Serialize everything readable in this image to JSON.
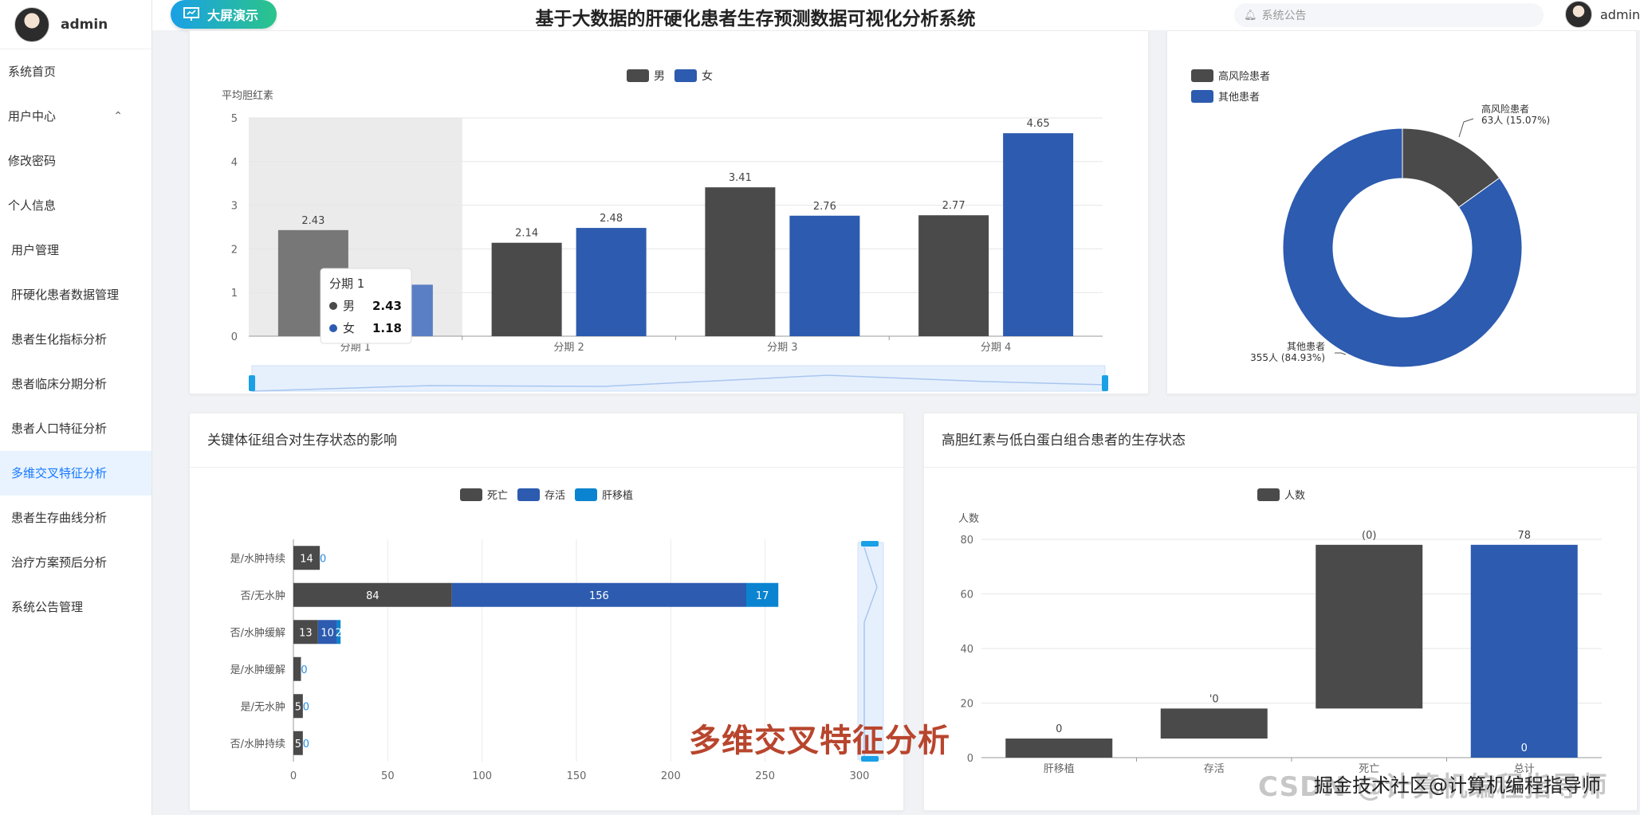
{
  "sidebar": {
    "username": "admin",
    "items": [
      {
        "label": "系统首页"
      },
      {
        "label": "用户中心"
      },
      {
        "label": "修改密码"
      },
      {
        "label": "个人信息"
      },
      {
        "label": "用户管理"
      },
      {
        "label": "肝硬化患者数据管理"
      },
      {
        "label": "患者生化指标分析"
      },
      {
        "label": "患者临床分期分析"
      },
      {
        "label": "患者人口特征分析"
      },
      {
        "label": "多维交叉特征分析"
      },
      {
        "label": "患者生存曲线分析"
      },
      {
        "label": "治疗方案预后分析"
      },
      {
        "label": "系统公告管理"
      }
    ],
    "active_item": "多维交叉特征分析"
  },
  "header": {
    "screen_button": "大屏演示",
    "title": "基于大数据的肝硬化患者生存预测数据可视化分析系统",
    "notice_placeholder": "系统公告",
    "username": "admin"
  },
  "colors": {
    "dark": "#4a4a4a",
    "blue": "#2c5baf",
    "cyan": "#0a84d0",
    "active_bg": "#e8f3ff",
    "active_text": "#1677ff"
  },
  "chart_data": [
    {
      "type": "bar",
      "title": "",
      "ylabel": "平均胆红素",
      "categories": [
        "分期 1",
        "分期 2",
        "分期 3",
        "分期 4"
      ],
      "series": [
        {
          "name": "男",
          "values": [
            2.43,
            2.14,
            3.41,
            2.77
          ]
        },
        {
          "name": "女",
          "values": [
            1.18,
            2.48,
            2.76,
            4.65
          ]
        }
      ],
      "ylim": [
        0,
        5
      ],
      "yticks": [
        0,
        1,
        2,
        3,
        4,
        5
      ],
      "legend": "top-center",
      "tooltip": {
        "title": "分期 1",
        "rows": [
          {
            "name": "男",
            "value": "2.43"
          },
          {
            "name": "女",
            "value": "1.18"
          }
        ]
      }
    },
    {
      "type": "pie",
      "title": "",
      "slices": [
        {
          "name": "高风险患者",
          "value": 63,
          "label": "高风险患者",
          "label2": "63人 (15.07%)"
        },
        {
          "name": "其他患者",
          "value": 355,
          "label": "其他患者",
          "label2": "355人 (84.93%)"
        }
      ],
      "legend": "top-left"
    },
    {
      "type": "bar",
      "title": "关键体征组合对生存状态的影响",
      "orientation": "horizontal",
      "categories": [
        "是/水肿持续",
        "否/无水肿",
        "否/水肿缓解",
        "是/水肿缓解",
        "是/无水肿",
        "否/水肿持续"
      ],
      "series": [
        {
          "name": "死亡",
          "values": [
            14,
            84,
            13,
            4,
            5,
            5
          ],
          "labels": [
            "14",
            "84",
            "13",
            "",
            "5",
            "5"
          ]
        },
        {
          "name": "存活",
          "values": [
            0,
            156,
            10,
            0,
            0,
            0
          ],
          "labels": [
            "",
            "156",
            "10",
            "",
            "",
            ""
          ]
        },
        {
          "name": "肝移植",
          "values": [
            0,
            17,
            2,
            0,
            0,
            0
          ],
          "labels": [
            "0",
            "17",
            "2",
            "0",
            "0",
            "0"
          ]
        }
      ],
      "xlim": [
        0,
        300
      ],
      "xticks": [
        0,
        50,
        100,
        150,
        200,
        250,
        300
      ],
      "legend": "top-center"
    },
    {
      "type": "bar",
      "title": "高胆红素与低白蛋白组合患者的生存状态",
      "categories": [
        "肝移植",
        "存活",
        "死亡",
        "总计"
      ],
      "series": [
        {
          "name": "人数",
          "values": [
            0,
            0,
            0,
            78
          ]
        }
      ],
      "ylabel": "人数",
      "ylim": [
        0,
        80
      ],
      "yticks": [
        0,
        20,
        40,
        60,
        80
      ],
      "value_labels": [
        "0",
        "'0",
        "(0)",
        "78"
      ],
      "legend": "top-center"
    }
  ],
  "watermark": {
    "overlay": "多维交叉特征分析",
    "site": "CSDN @计算机编程指导师",
    "credit": "掘金技术社区@计算机编程指导师"
  }
}
